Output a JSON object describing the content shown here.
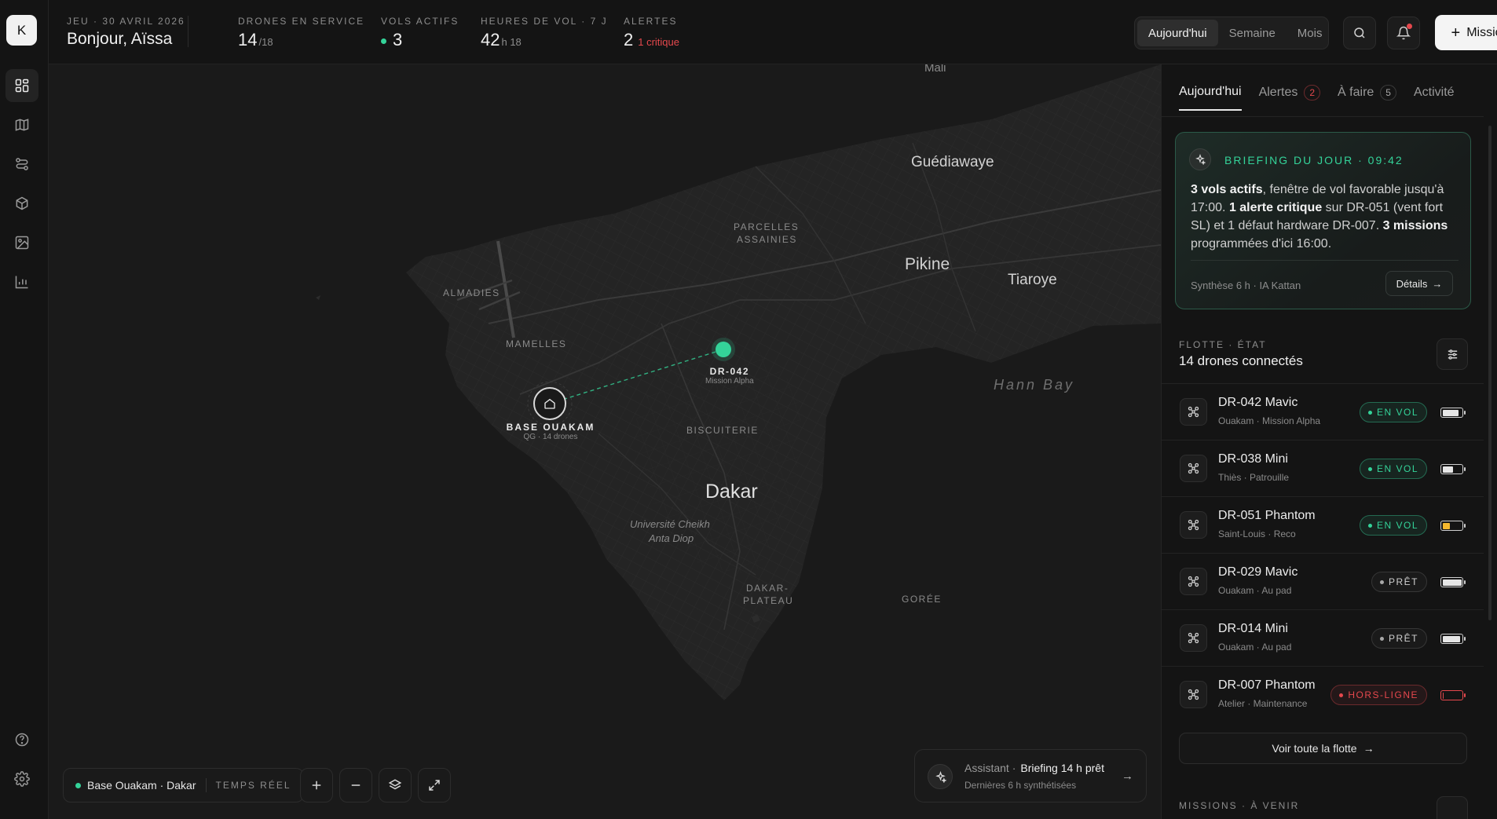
{
  "app": {
    "logo_letter": "K"
  },
  "sidebar": {
    "items": [
      {
        "name": "dashboard-icon",
        "active": true
      },
      {
        "name": "map-icon",
        "active": false
      },
      {
        "name": "routes-icon",
        "active": false
      },
      {
        "name": "package-icon",
        "active": false
      },
      {
        "name": "image-icon",
        "active": false
      },
      {
        "name": "analytics-icon",
        "active": false
      }
    ],
    "bottom": [
      {
        "name": "help-icon"
      },
      {
        "name": "settings-icon"
      }
    ]
  },
  "header": {
    "date": "JEU · 30 AVRIL 2026",
    "greeting": "Bonjour, Aïssa",
    "stats": {
      "drones_label": "DRONES EN SERVICE",
      "drones_value": "14",
      "drones_total": "/18",
      "flights_label": "VOLS ACTIFS",
      "flights_value": "3",
      "hours_label": "HEURES DE VOL · 7 J",
      "hours_value": "42",
      "hours_unit": "h 18",
      "alerts_label": "ALERTES",
      "alerts_value": "2",
      "alerts_critical": "1 critique"
    },
    "period": {
      "options": [
        "Aujourd'hui",
        "Semaine",
        "Mois"
      ],
      "selected": "Aujourd'hui"
    },
    "mission_button": "Mission"
  },
  "map": {
    "labels": {
      "mali": "Mali",
      "guediawaye": "Guédiawaye",
      "parcelles1": "PARCELLES",
      "parcelles2": "ASSAINIES",
      "pikine": "Pikine",
      "tiaroye": "Tiaroye",
      "almadies": "ALMADIES",
      "mamelles": "MAMELLES",
      "hann_bay": "Hann Bay",
      "biscuiterie": "BISCUITERIE",
      "dakar": "Dakar",
      "ucad1": "Université Cheikh",
      "ucad2": "Anta Diop",
      "plateau1": "DAKAR-",
      "plateau2": "PLATEAU",
      "goree": "GORÉE"
    },
    "drone": {
      "id": "DR-042",
      "mission": "Mission Alpha"
    },
    "base": {
      "name": "BASE OUAKAM",
      "sub": "QG · 14 drones"
    },
    "status": {
      "location": "Base Ouakam · Dakar",
      "mode": "TEMPS RÉEL"
    },
    "assistant": {
      "label": "Assistant ·",
      "title": "Briefing 14 h prêt",
      "sub": "Dernières 6 h synthétisées"
    }
  },
  "panel": {
    "tabs": [
      {
        "label": "Aujourd'hui",
        "active": true,
        "badge": ""
      },
      {
        "label": "Alertes",
        "active": false,
        "badge": "2"
      },
      {
        "label": "À faire",
        "active": false,
        "badge": "5"
      },
      {
        "label": "Activité",
        "active": false,
        "badge": ""
      }
    ],
    "briefing": {
      "title": "BRIEFING DU JOUR · 09:42",
      "b1": "3 vols actifs",
      "t1": ", fenêtre de vol favorable jusqu'à 17:00. ",
      "b2": "1 alerte critique",
      "t2": " sur DR-051 (vent fort SL) et 1 défaut hardware DR-007. ",
      "b3": "3 missions",
      "t3": " programmées d'ici 16:00.",
      "footer": "Synthèse 6 h · IA Kattan",
      "details": "Détails"
    },
    "fleet": {
      "label": "FLOTTE · ÉTAT",
      "title": "14 drones connectés",
      "drones": [
        {
          "name": "DR-042 Mavic",
          "sub": "Ouakam · Mission Alpha",
          "status": "EN VOL",
          "kind": "fly",
          "battery": 0.85,
          "battery_color": "#e6e6e6"
        },
        {
          "name": "DR-038 Mini",
          "sub": "Thiès · Patrouille",
          "status": "EN VOL",
          "kind": "fly",
          "battery": 0.55,
          "battery_color": "#e6e6e6"
        },
        {
          "name": "DR-051 Phantom",
          "sub": "Saint-Louis · Reco",
          "status": "EN VOL",
          "kind": "fly",
          "battery": 0.4,
          "battery_color": "#f5b82e"
        },
        {
          "name": "DR-029 Mavic",
          "sub": "Ouakam · Au pad",
          "status": "PRÊT",
          "kind": "ready",
          "battery": 1.0,
          "battery_color": "#e6e6e6"
        },
        {
          "name": "DR-014 Mini",
          "sub": "Ouakam · Au pad",
          "status": "PRÊT",
          "kind": "ready",
          "battery": 0.95,
          "battery_color": "#e6e6e6"
        },
        {
          "name": "DR-007 Phantom",
          "sub": "Atelier · Maintenance",
          "status": "HORS-LIGNE",
          "kind": "off",
          "battery": 0.08,
          "battery_color": "#e5484d"
        }
      ],
      "see_all": "Voir toute la flotte"
    },
    "missions_label": "MISSIONS · À VENIR"
  },
  "colors": {
    "accent": "#34d399",
    "danger": "#e5484d",
    "warning": "#f5b82e"
  }
}
